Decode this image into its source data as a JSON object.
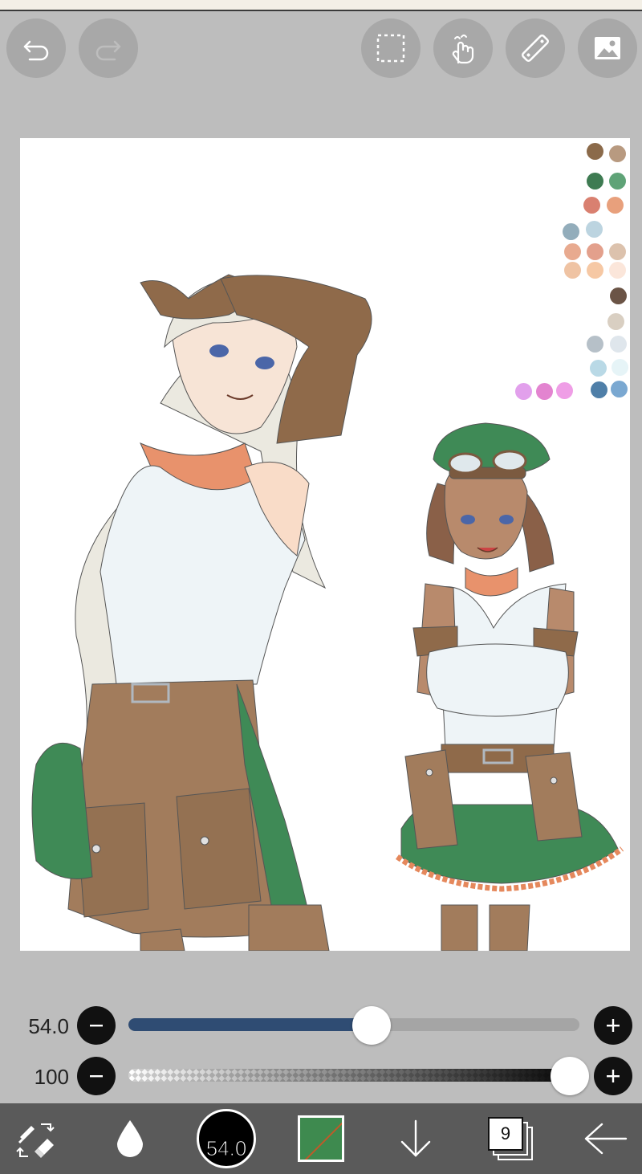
{
  "toolbar": {
    "undo_icon": "undo-icon",
    "redo_icon": "redo-icon",
    "selection_icon": "selection-icon",
    "hand_icon": "hand-icon",
    "ruler_icon": "ruler-icon",
    "gallery_icon": "image-icon"
  },
  "palette": {
    "swatches": [
      "#8b6a4a",
      "#b89a80",
      "#3e7b52",
      "#5fa377",
      "#d98070",
      "#e8a07c",
      "#93adbb",
      "#bcd4e0",
      "#e8aa8f",
      "#e3a08c",
      "#dcc2ad",
      "#efc3a3",
      "#f6c8a4",
      "#fbe6da",
      "#6b5446",
      "#d9cfc2",
      "#b6c0c8",
      "#dfe6ec",
      "#b9d9e6",
      "#e6f4f7",
      "#4f7fa8",
      "#7aa8d1",
      "#e2a0ec",
      "#e384d0",
      "#ef9ee6"
    ]
  },
  "brush_size": {
    "value": "54.0",
    "fraction": 0.575,
    "decrease_icon": "minus-icon",
    "increase_icon": "plus-icon"
  },
  "opacity": {
    "value": "100",
    "fraction": 1.0,
    "decrease_icon": "minus-icon",
    "increase_icon": "plus-icon"
  },
  "bottombar": {
    "tool_icon": "brush-eraser-swap-icon",
    "dropper_icon": "water-drop-icon",
    "brush_size_label": "54.0",
    "color_hex": "#3e8a4f",
    "download_icon": "arrow-down-icon",
    "layer_count": "9",
    "back_icon": "arrow-left-icon"
  }
}
